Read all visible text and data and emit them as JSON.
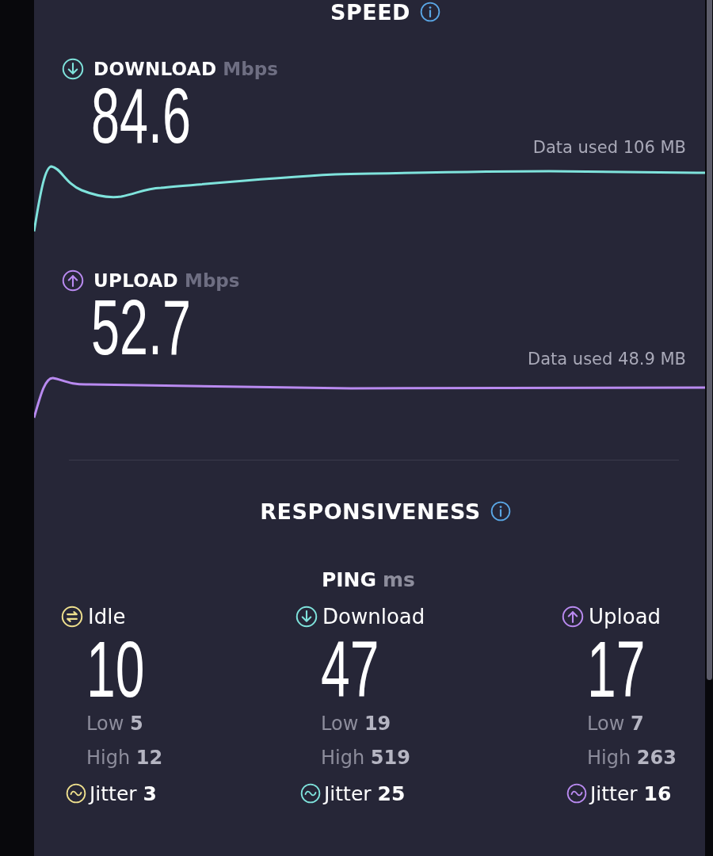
{
  "speed": {
    "title": "SPEED",
    "metrics": [
      {
        "kind": "download",
        "label": "DOWNLOAD",
        "unit": "Mbps",
        "value": "84.6",
        "data_used": "Data used 106 MB"
      },
      {
        "kind": "upload",
        "label": "UPLOAD",
        "unit": "Mbps",
        "value": "52.7",
        "data_used": "Data used 48.9 MB"
      }
    ]
  },
  "responsiveness": {
    "title": "RESPONSIVENESS",
    "ping": {
      "label": "PING",
      "unit": "ms",
      "columns": [
        {
          "kind": "idle",
          "label": "Idle",
          "value": "10",
          "low": "Low **5**",
          "high": "High **12**",
          "jitter": "Jitter **3**"
        },
        {
          "kind": "download",
          "label": "Download",
          "value": "47",
          "low": "Low **19**",
          "high": "High **519**",
          "jitter": "Jitter **25**"
        },
        {
          "kind": "upload",
          "label": "Upload",
          "value": "17",
          "low": "Low **7**",
          "high": "High **263**",
          "jitter": "Jitter **16**"
        }
      ]
    }
  }
}
